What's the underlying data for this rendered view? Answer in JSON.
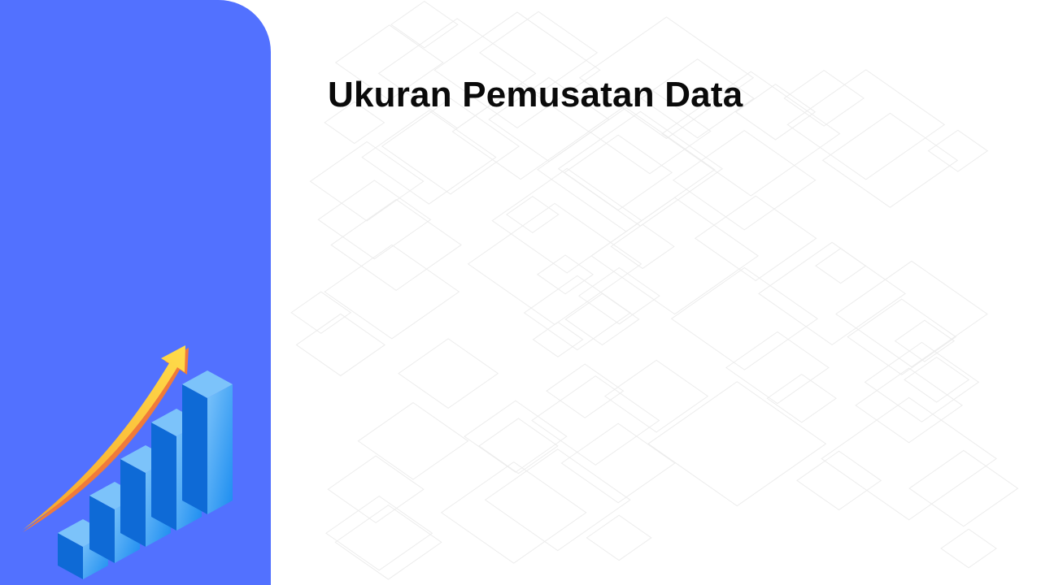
{
  "slide": {
    "title": "Ukuran Pemusatan Data"
  },
  "colors": {
    "panel": "#5271ff",
    "title": "#0a0a0a",
    "bar_top": "#7cc3fa",
    "bar_left": "#0e6ad6",
    "bar_right": "#3fa2f6",
    "arrow": "#ffc53a",
    "arrow_shadow": "#f07a3a"
  },
  "illustration": {
    "icon": "growth-bar-chart-with-arrow-icon"
  }
}
